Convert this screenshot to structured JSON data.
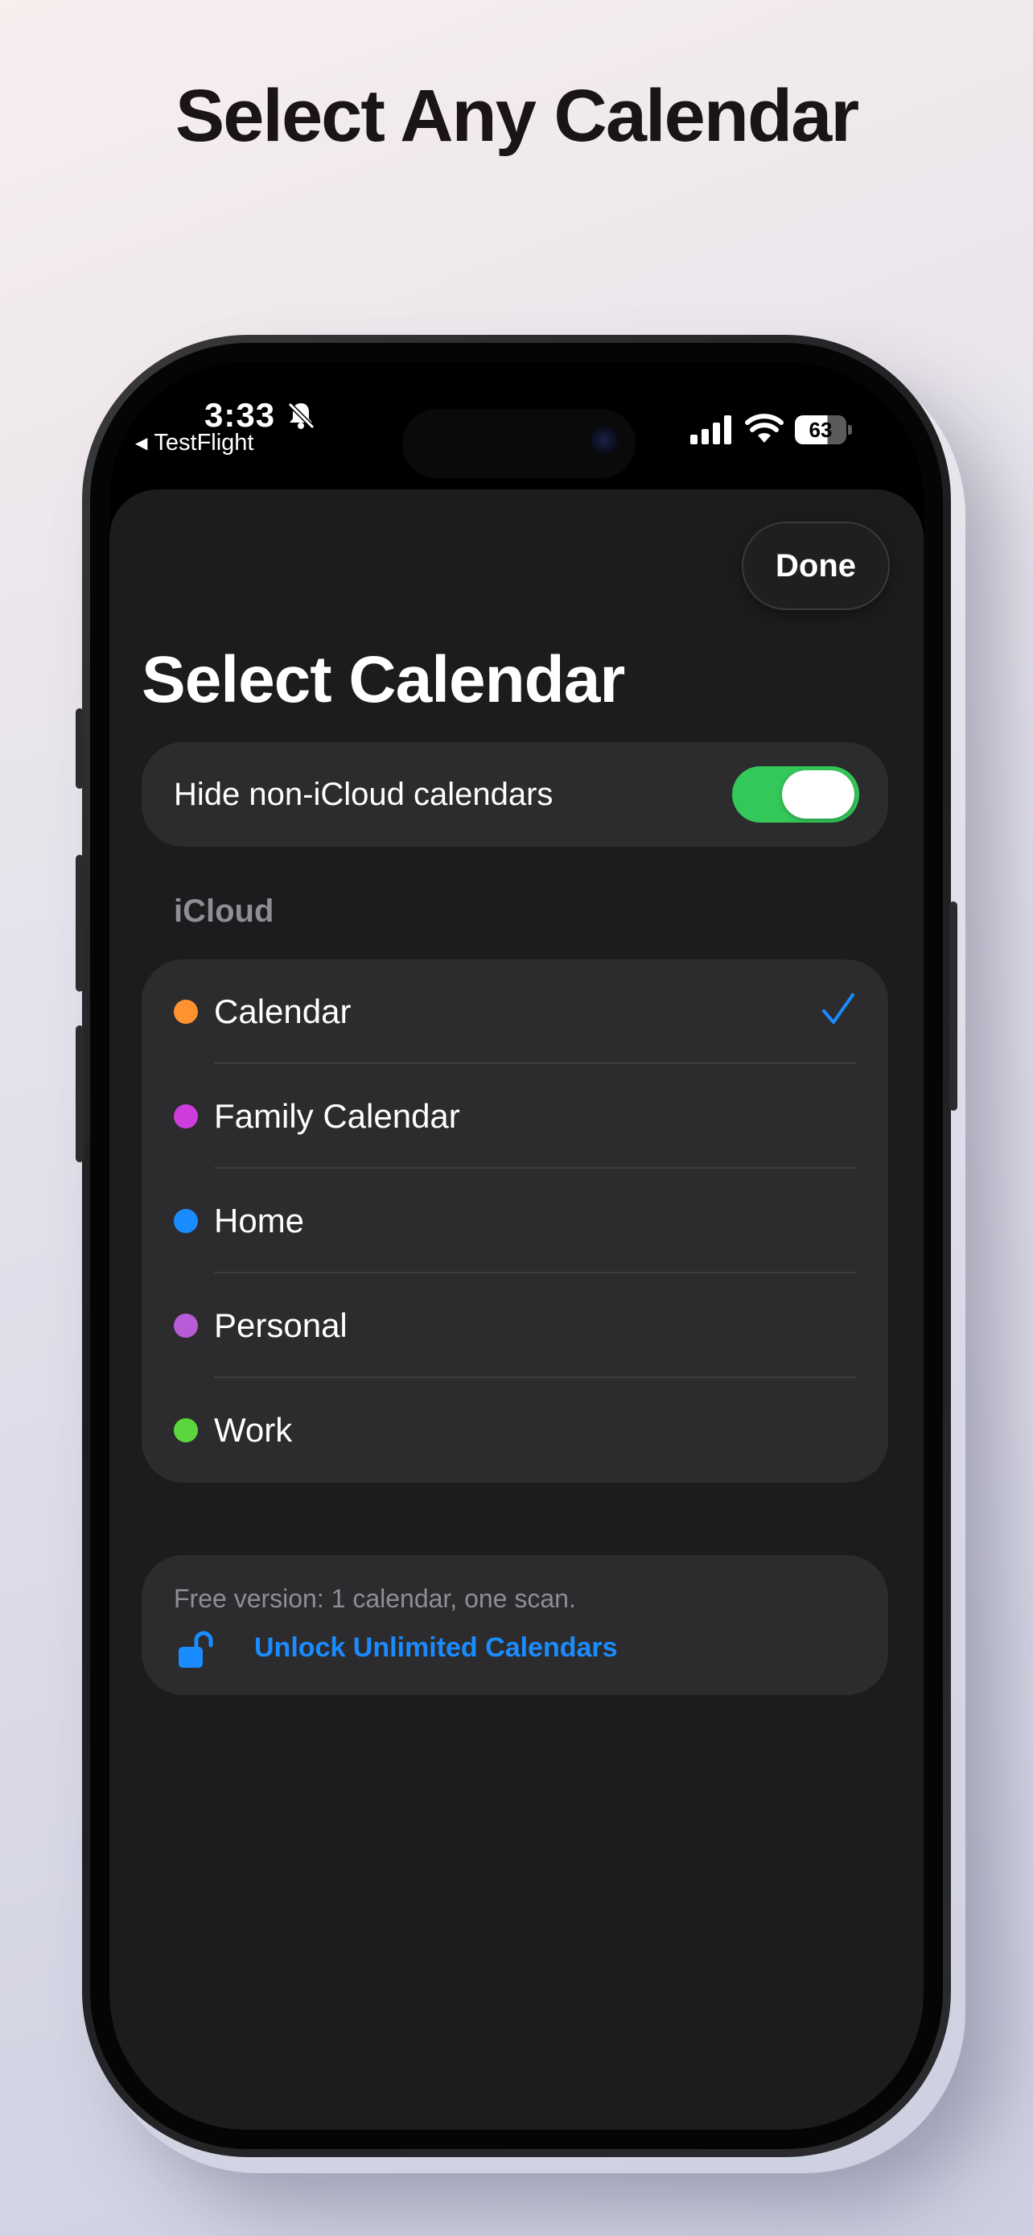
{
  "headline": "Select Any Calendar",
  "status_bar": {
    "time": "3:33",
    "back_app": "TestFlight",
    "battery": "63",
    "battery_level": 0.63
  },
  "sheet": {
    "done_label": "Done",
    "title": "Select Calendar",
    "toggle": {
      "label": "Hide non-iCloud calendars",
      "on": true,
      "color": "#34c759"
    },
    "section_header": "iCloud",
    "calendars": [
      {
        "name": "Calendar",
        "color": "#ff9230",
        "selected": true
      },
      {
        "name": "Family Calendar",
        "color": "#cc3ddb",
        "selected": false
      },
      {
        "name": "Home",
        "color": "#1a8cff",
        "selected": false
      },
      {
        "name": "Personal",
        "color": "#b85bd6",
        "selected": false
      },
      {
        "name": "Work",
        "color": "#5bd63c",
        "selected": false
      }
    ],
    "upsell": {
      "text": "Free version: 1 calendar, one scan.",
      "link": "Unlock Unlimited Calendars",
      "accent": "#1a8cff"
    }
  }
}
